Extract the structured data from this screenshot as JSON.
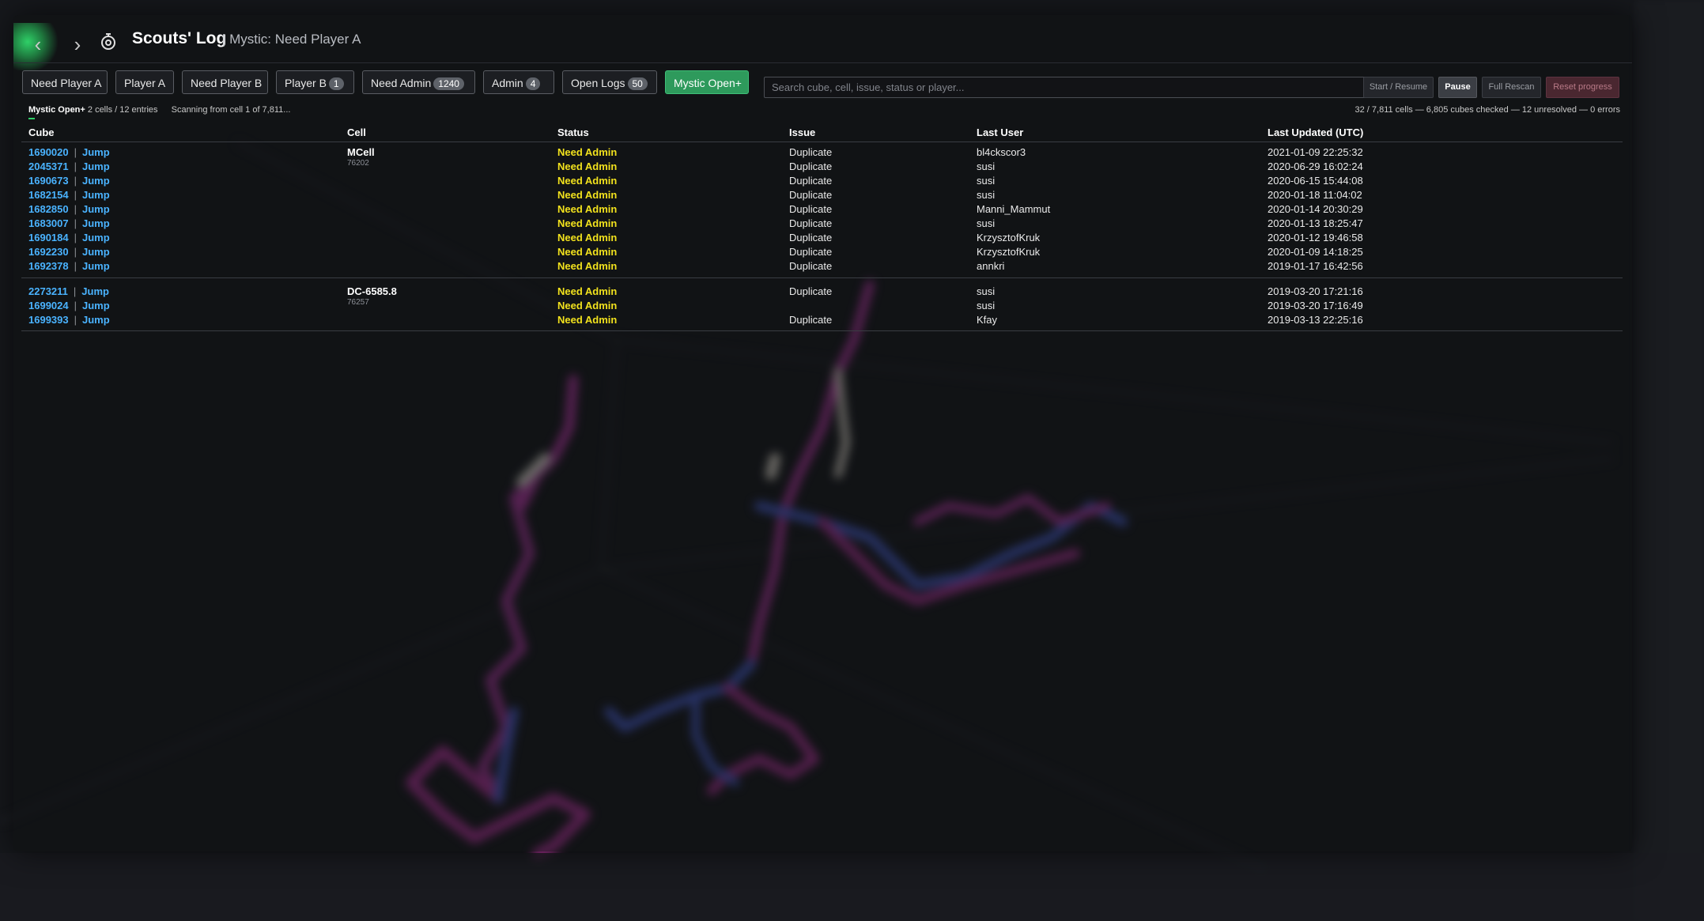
{
  "header": {
    "title": "Scouts' Log",
    "subtitle": "| Mystic: Need Player A",
    "back_glyph": "‹",
    "forward_glyph": "›",
    "title_icon": "stopwatch-icon"
  },
  "tabs": [
    {
      "label": "Need Player A",
      "badge": ""
    },
    {
      "label": "Player A",
      "badge": ""
    },
    {
      "label": "Need Player B",
      "badge": ""
    },
    {
      "label": "Player B",
      "badge": "1"
    },
    {
      "label": "Need Admin",
      "badge": "1240"
    },
    {
      "label": "Admin",
      "badge": "4"
    },
    {
      "label": "Open Logs",
      "badge": "50"
    },
    {
      "label": "Mystic Open+",
      "badge": "",
      "active": true
    }
  ],
  "search": {
    "placeholder": "Search cube, cell, issue, status or player...",
    "value": ""
  },
  "controls": {
    "start_resume": "Start / Resume",
    "pause": "Pause",
    "full_rescan": "Full Rescan",
    "reset_progress": "Reset progress"
  },
  "status": {
    "filter_name": "Mystic Open+",
    "summary": "2 cells / 12 entries",
    "scanning": "Scanning from cell 1 of 7,811...",
    "right": "32 / 7,811 cells — 6,805 cubes checked — 12 unresolved — 0 errors"
  },
  "table": {
    "columns": [
      "Cube",
      "Cell",
      "Status",
      "Issue",
      "Last User",
      "Last Updated (UTC)"
    ],
    "jump_label": "Jump",
    "sep": "|",
    "groups": [
      {
        "cell_name": "MCell",
        "cell_id": "76202",
        "rows": [
          {
            "cube": "1690020",
            "status": "Need Admin",
            "issue": "Duplicate",
            "user": "bl4ckscor3",
            "updated": "2021-01-09 22:25:32"
          },
          {
            "cube": "2045371",
            "status": "Need Admin",
            "issue": "Duplicate",
            "user": "susi",
            "updated": "2020-06-29 16:02:24"
          },
          {
            "cube": "1690673",
            "status": "Need Admin",
            "issue": "Duplicate",
            "user": "susi",
            "updated": "2020-06-15 15:44:08"
          },
          {
            "cube": "1682154",
            "status": "Need Admin",
            "issue": "Duplicate",
            "user": "susi",
            "updated": "2020-01-18 11:04:02"
          },
          {
            "cube": "1682850",
            "status": "Need Admin",
            "issue": "Duplicate",
            "user": "Manni_Mammut",
            "updated": "2020-01-14 20:30:29"
          },
          {
            "cube": "1683007",
            "status": "Need Admin",
            "issue": "Duplicate",
            "user": "susi",
            "updated": "2020-01-13 18:25:47"
          },
          {
            "cube": "1690184",
            "status": "Need Admin",
            "issue": "Duplicate",
            "user": "KrzysztofKruk",
            "updated": "2020-01-12 19:46:58"
          },
          {
            "cube": "1692230",
            "status": "Need Admin",
            "issue": "Duplicate",
            "user": "KrzysztofKruk",
            "updated": "2020-01-09 14:18:25"
          },
          {
            "cube": "1692378",
            "status": "Need Admin",
            "issue": "Duplicate",
            "user": "annkri",
            "updated": "2019-01-17 16:42:56"
          }
        ]
      },
      {
        "cell_name": "DC-6585.8",
        "cell_id": "76257",
        "rows": [
          {
            "cube": "2273211",
            "status": "Need Admin",
            "issue": "Duplicate",
            "user": "susi",
            "updated": "2019-03-20 17:21:16"
          },
          {
            "cube": "1699024",
            "status": "Need Admin",
            "issue": "",
            "user": "susi",
            "updated": "2019-03-20 17:16:49"
          },
          {
            "cube": "1699393",
            "status": "Need Admin",
            "issue": "Duplicate",
            "user": "Kfay",
            "updated": "2019-03-13 22:25:16"
          }
        ]
      }
    ]
  },
  "colors": {
    "accent_green": "#2e9a5c",
    "link_blue": "#4ab3ff",
    "status_yellow": "#f2e21d",
    "reset_red": "#4a2730"
  }
}
